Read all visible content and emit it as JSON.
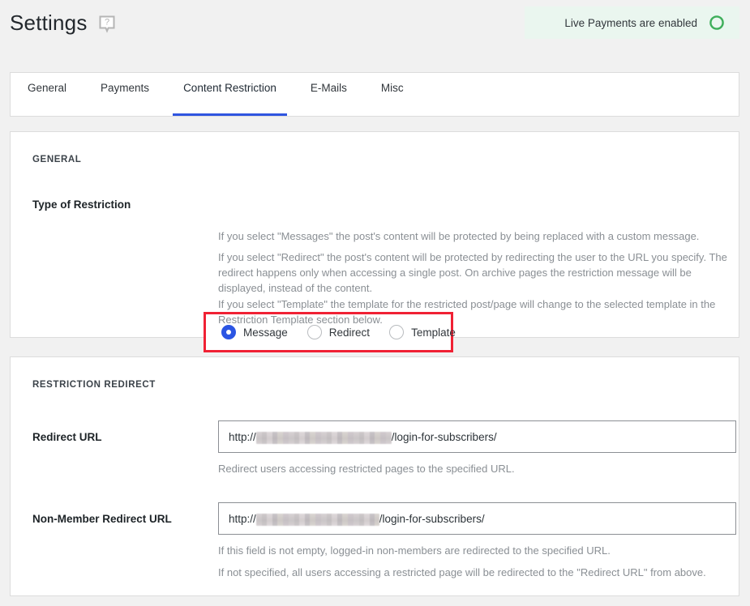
{
  "header": {
    "title": "Settings",
    "help_icon": "help-speech-bubble-icon",
    "live_badge": {
      "text": "Live Payments are enabled",
      "icon": "green-circle-icon",
      "background": "#eaf6ef",
      "accent": "#3eae5a"
    }
  },
  "tabs": {
    "active_index": 2,
    "accent": "#2f55e0",
    "items": [
      {
        "label": "General"
      },
      {
        "label": "Payments"
      },
      {
        "label": "Content Restriction"
      },
      {
        "label": "E-Mails"
      },
      {
        "label": "Misc"
      }
    ]
  },
  "general_section": {
    "heading": "GENERAL",
    "field_label": "Type of Restriction",
    "highlight_color": "#f02134",
    "radio_selected": "Message",
    "radios": [
      {
        "label": "Message",
        "checked": true
      },
      {
        "label": "Redirect",
        "checked": false
      },
      {
        "label": "Template",
        "checked": false
      }
    ],
    "descriptions": [
      "If you select \"Messages\" the post's content will be protected by being replaced with a custom message.",
      "If you select \"Redirect\" the post's content will be protected by redirecting the user to the URL you specify. The redirect happens only when accessing a single post. On archive pages the restriction message will be displayed, instead of the content.",
      "If you select \"Template\" the template for the restricted post/page will change to the selected template in the Restriction Template section below."
    ]
  },
  "redirect_section": {
    "heading": "RESTRICTION REDIRECT",
    "redirect_url": {
      "label": "Redirect URL",
      "value_prefix": "http://",
      "value_redacted": "redacted-domain",
      "value_suffix": "/login-for-subscribers/",
      "help": "Redirect users accessing restricted pages to the specified URL."
    },
    "non_member_redirect_url": {
      "label": "Non-Member Redirect URL",
      "value_prefix": "http://",
      "value_redacted": "redacted-domain",
      "value_suffix": "/login-for-subscribers/",
      "help_lines": [
        "If this field is not empty, logged-in non-members are redirected to the specified URL.",
        "If not specified, all users accessing a restricted page will be redirected to the \"Redirect URL\" from above."
      ]
    }
  }
}
